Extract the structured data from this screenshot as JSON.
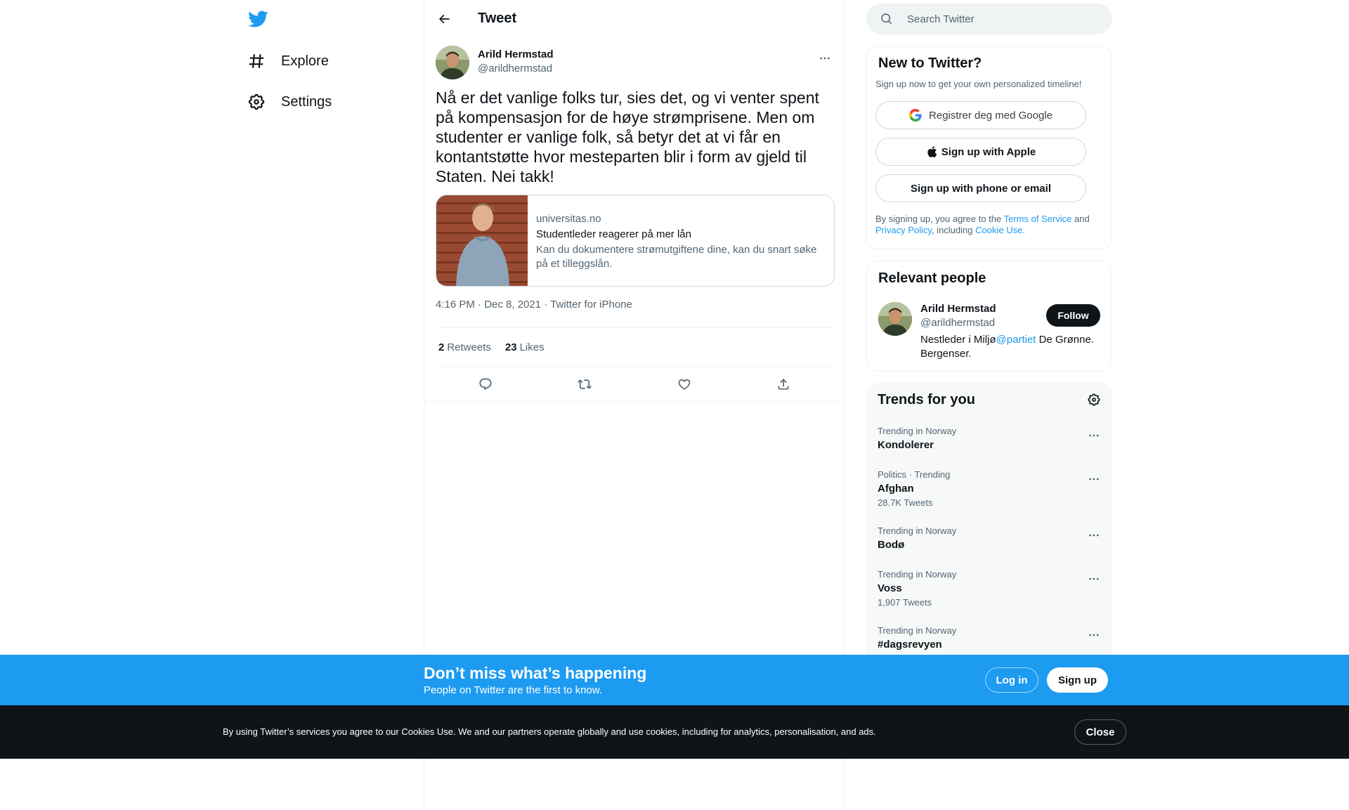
{
  "nav": {
    "items": [
      {
        "label": "Explore",
        "icon": "hashtag-icon"
      },
      {
        "label": "Settings",
        "icon": "gear-icon"
      }
    ]
  },
  "header": {
    "title": "Tweet"
  },
  "tweet": {
    "author_name": "Arild Hermstad",
    "author_handle": "@arildhermstad",
    "text": "Nå er det vanlige folks tur, sies det, og vi venter spent på kompensasjon for de høye strømprisene. Men om studenter er vanlige folk, så betyr det at vi får en kontantstøtte hvor mesteparten blir i form av gjeld til Staten. Nei takk!",
    "card": {
      "domain": "universitas.no",
      "title": "Studentleder reagerer på mer lån",
      "description": "Kan du dokumentere strømutgiftene dine, kan du snart søke på et tilleggslån."
    },
    "timestamp": "4:16 PM · Dec 8, 2021 · Twitter for iPhone",
    "retweets_count": "2",
    "retweets_label": "Retweets",
    "likes_count": "23",
    "likes_label": "Likes"
  },
  "search": {
    "placeholder": "Search Twitter"
  },
  "signup_box": {
    "title": "New to Twitter?",
    "subtitle": "Sign up now to get your own personalized timeline!",
    "google_label": "Registrer deg med Google",
    "apple_label": "Sign up with Apple",
    "phone_label": "Sign up with phone or email",
    "terms_prefix": "By signing up, you agree to the ",
    "terms_link": "Terms of Service",
    "terms_and": " and ",
    "privacy_link": "Privacy Policy",
    "terms_including": ", including ",
    "cookie_link": "Cookie Use."
  },
  "people": {
    "title": "Relevant people",
    "name": "Arild Hermstad",
    "handle": "@arildhermstad",
    "bio_prefix": "Nestleder i Miljø",
    "bio_mention": "@partiet",
    "bio_suffix": " De Grønne. Bergenser.",
    "follow_label": "Follow"
  },
  "trends": {
    "title": "Trends for you",
    "items": [
      {
        "context": "Trending in Norway",
        "name": "Kondolerer",
        "count": ""
      },
      {
        "context": "Politics · Trending",
        "name": "Afghan",
        "count": "28.7K Tweets"
      },
      {
        "context": "Trending in Norway",
        "name": "Bodø",
        "count": ""
      },
      {
        "context": "Trending in Norway",
        "name": "Voss",
        "count": "1,907 Tweets"
      },
      {
        "context": "Trending in Norway",
        "name": "#dagsrevyen",
        "count": ""
      }
    ]
  },
  "promo": {
    "title": "Don’t miss what’s happening",
    "subtitle": "People on Twitter are the first to know.",
    "login_label": "Log in",
    "signup_label": "Sign up"
  },
  "cookie": {
    "text": "By using Twitter’s services you agree to our Cookies Use. We and our partners operate globally and use cookies, including for analytics, personalisation, and ads.",
    "close_label": "Close"
  },
  "colors": {
    "brand_blue": "#1d9bf0",
    "text_primary": "#0f1419",
    "text_secondary": "#536471",
    "cookie_bg": "#0f1419"
  }
}
